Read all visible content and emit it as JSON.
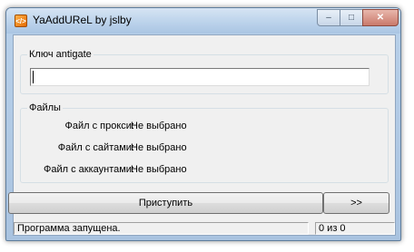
{
  "window": {
    "title": "YaAddUReL by jslby",
    "icon": "app-logo-icon",
    "controls": {
      "minimize": "–",
      "maximize": "□",
      "close": "✕"
    }
  },
  "antigate": {
    "group_label": "Ключ antigate",
    "value": ""
  },
  "files": {
    "group_label": "Файлы",
    "rows": [
      {
        "label": "Файл с прокси:",
        "value": "Не выбрано"
      },
      {
        "label": "Файл с сайтами:",
        "value": "Не выбрано"
      },
      {
        "label": "Файл с аккаунтами:",
        "value": "Не выбрано"
      }
    ]
  },
  "actions": {
    "start_label": "Приступить",
    "next_label": ">>"
  },
  "status": {
    "message": "Программа запущена.",
    "counter": "0 из 0"
  }
}
